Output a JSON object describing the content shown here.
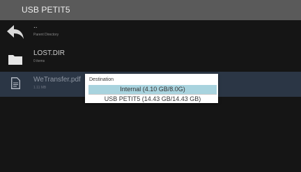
{
  "header": {
    "title": "USB PETIT5"
  },
  "files": [
    {
      "name": "..",
      "detail": "Parent Directory",
      "icon": "back-arrow-icon"
    },
    {
      "name": "LOST.DIR",
      "detail": "0 items",
      "icon": "folder-icon"
    },
    {
      "name": "WeTransfer.pdf",
      "detail": "1.11 MB",
      "icon": "document-icon"
    }
  ],
  "dialog": {
    "title": "Destination",
    "options": [
      {
        "label": "Internal (4.10 GB/8.0G)",
        "selected": true
      },
      {
        "label": "USB PETIT5 (14.43 GB/14.43 GB)",
        "selected": false
      }
    ]
  },
  "colors": {
    "background": "#151515",
    "header": "#5a5a5a",
    "selected_row": "#2b3645",
    "selected_option": "#a8d3de"
  }
}
